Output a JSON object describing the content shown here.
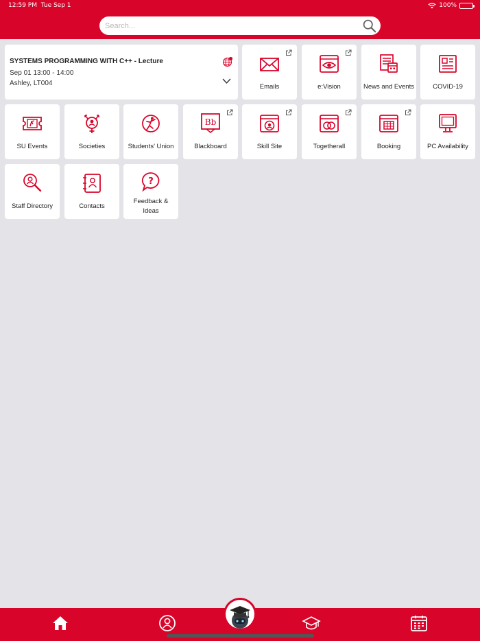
{
  "status_bar": {
    "time": "12:59 PM",
    "date": "Tue Sep 1",
    "battery": "100%"
  },
  "search": {
    "placeholder": "Search..."
  },
  "lecture": {
    "title": "SYSTEMS PROGRAMMING WITH C++ - Lecture",
    "time": "Sep 01 13:00 - 14:00",
    "location": "Ashley, LT004"
  },
  "tiles": [
    {
      "label": "Emails",
      "icon": "envelope-icon",
      "external": true
    },
    {
      "label": "e:Vision",
      "icon": "eye-icon",
      "external": true
    },
    {
      "label": "News and Events",
      "icon": "news-events-icon",
      "external": false
    },
    {
      "label": "COVID-19",
      "icon": "newspaper-icon",
      "external": false
    },
    {
      "label": "SU Events",
      "icon": "ticket-icon",
      "external": false
    },
    {
      "label": "Societies",
      "icon": "societies-icon",
      "external": false
    },
    {
      "label": "Students' Union",
      "icon": "students-union-icon",
      "external": false
    },
    {
      "label": "Blackboard",
      "icon": "blackboard-icon",
      "external": true
    },
    {
      "label": "Skill Site",
      "icon": "skill-site-icon",
      "external": true
    },
    {
      "label": "Togetherall",
      "icon": "togetherall-icon",
      "external": true
    },
    {
      "label": "Booking",
      "icon": "booking-icon",
      "external": true
    },
    {
      "label": "PC Availability",
      "icon": "monitor-icon",
      "external": false
    },
    {
      "label": "Staff Directory",
      "icon": "staff-search-icon",
      "external": false
    },
    {
      "label": "Contacts",
      "icon": "contacts-icon",
      "external": false
    },
    {
      "label": "Feedback & Ideas",
      "icon": "feedback-icon",
      "external": false
    }
  ],
  "tab_bar": {
    "items": [
      {
        "icon": "home-icon"
      },
      {
        "icon": "profile-icon"
      },
      {
        "icon": "assistant-icon"
      },
      {
        "icon": "graduation-cap-icon"
      },
      {
        "icon": "calendar-icon"
      }
    ]
  },
  "colors": {
    "brand": "#d8042a",
    "background": "#e4e3e8",
    "tile": "#ffffff"
  }
}
